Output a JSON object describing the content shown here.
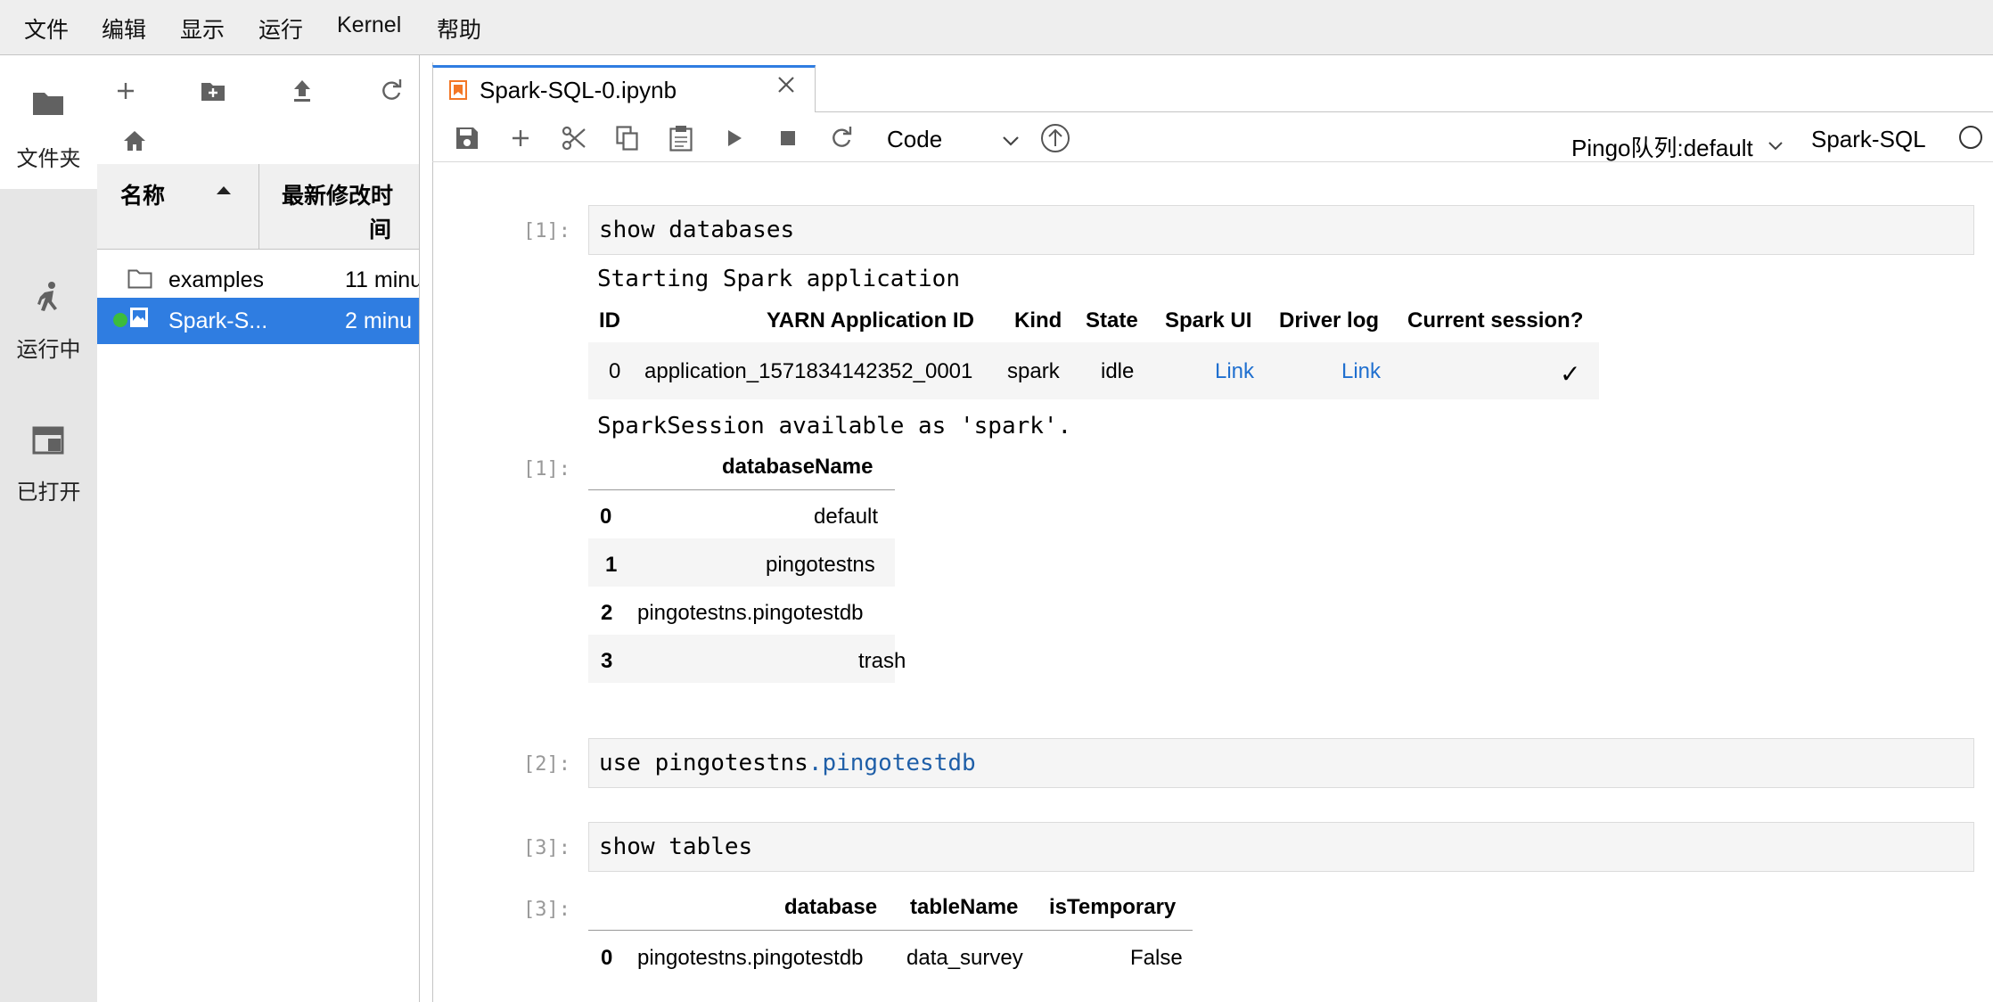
{
  "menubar": {
    "items": [
      "文件",
      "编辑",
      "显示",
      "运行",
      "Kernel",
      "帮助"
    ]
  },
  "activity": {
    "files_label": "文件夹",
    "running_label": "运行中",
    "opened_label": "已打开"
  },
  "filebrowser": {
    "col_name": "名称",
    "col_modified_line1": "最新修改时",
    "col_modified_line2": "间",
    "items": [
      {
        "name": "examples",
        "modified": "11 minu",
        "type": "folder"
      },
      {
        "name": "Spark-S...",
        "modified": "2 minu",
        "type": "notebook",
        "selected": true
      }
    ]
  },
  "tab": {
    "title": "Spark-SQL-0.ipynb"
  },
  "toolbar": {
    "cell_type": "Code",
    "queue": "Pingo队列:default",
    "kernel": "Spark-SQL"
  },
  "cells": [
    {
      "prompt_in": "[1]:",
      "source": "show databases",
      "output_text_1": "Starting Spark application",
      "session_table": {
        "headers": [
          "ID",
          "YARN Application ID",
          "Kind",
          "State",
          "Spark UI",
          "Driver log",
          "Current session?"
        ],
        "row": [
          "0",
          "application_1571834142352_0001",
          "spark",
          "idle",
          "Link",
          "Link",
          "✓"
        ]
      },
      "output_text_2": "SparkSession available as 'spark'.",
      "prompt_out": "[1]:",
      "result_table": {
        "header": "databaseName",
        "rows": [
          {
            "idx": "0",
            "value": "default"
          },
          {
            "idx": "1",
            "value": "pingotestns"
          },
          {
            "idx": "2",
            "value": "pingotestns.pingotestdb"
          },
          {
            "idx": "3",
            "value": "trash"
          }
        ]
      }
    },
    {
      "prompt_in": "[2]:",
      "source_a": "use pingotestns",
      "source_b": ".pingotestdb"
    },
    {
      "prompt_in": "[3]:",
      "source": "show tables",
      "prompt_out": "[3]:",
      "result_table": {
        "headers": [
          "database",
          "tableName",
          "isTemporary"
        ],
        "rows": [
          {
            "idx": "0",
            "database": "pingotestns.pingotestdb",
            "tableName": "data_survey",
            "isTemporary": "False"
          }
        ]
      }
    }
  ],
  "colors": {
    "accent": "#2f7de1",
    "link": "#1f6fcf",
    "notebook_icon": "#f37726",
    "kernel_dot": "#3cbc3c"
  }
}
